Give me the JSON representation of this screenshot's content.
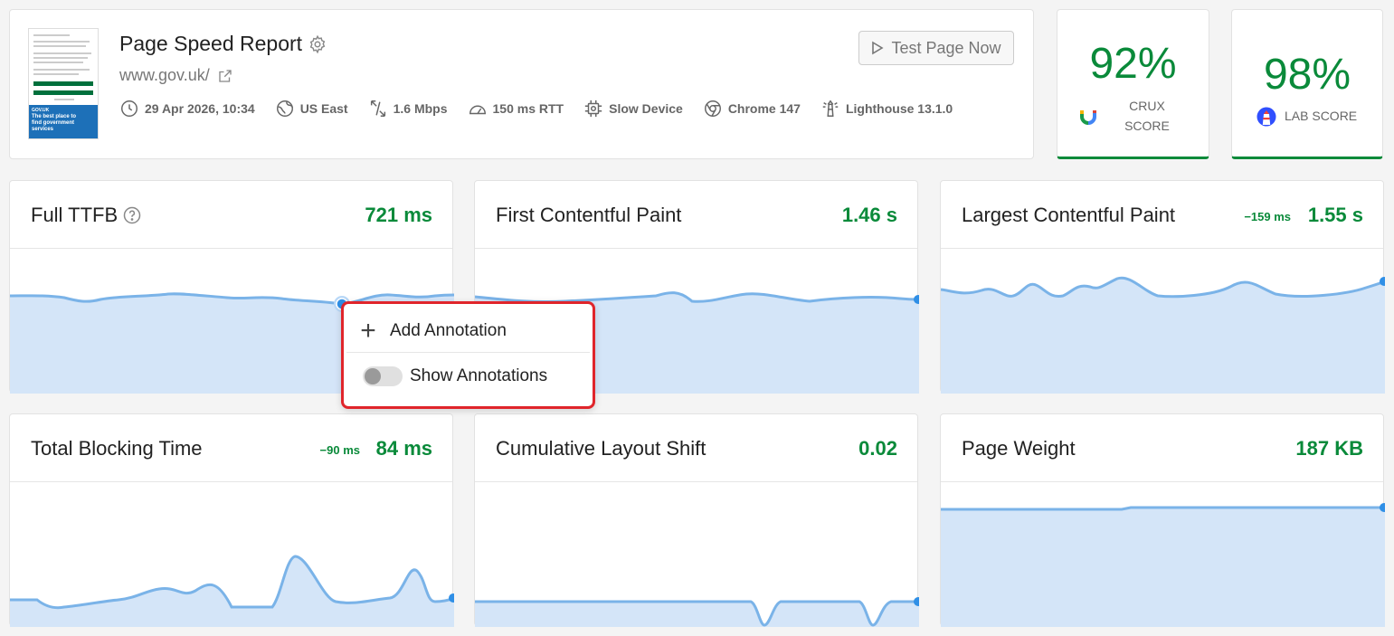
{
  "header": {
    "title": "Page Speed Report",
    "url": "www.gov.uk/",
    "test_button": "Test Page Now",
    "meta": [
      {
        "icon": "clock-icon",
        "label": "29 Apr 2026, 10:34"
      },
      {
        "icon": "globe-icon",
        "label": "US East"
      },
      {
        "icon": "bandwidth-icon",
        "label": "1.6 Mbps"
      },
      {
        "icon": "gauge-icon",
        "label": "150 ms RTT"
      },
      {
        "icon": "cpu-icon",
        "label": "Slow Device"
      },
      {
        "icon": "chrome-icon",
        "label": "Chrome 147"
      },
      {
        "icon": "lighthouse-icon",
        "label": "Lighthouse 13.1.0"
      }
    ],
    "thumbnail": {
      "logo": "GOV.UK",
      "headline": "The best place to find government services"
    }
  },
  "scores": {
    "crux": {
      "value": "92%",
      "label_line1": "CRUX",
      "label_line2": "SCORE"
    },
    "lab": {
      "value": "98%",
      "label": "LAB SCORE"
    }
  },
  "metrics": {
    "ttfb": {
      "title": "Full TTFB",
      "value": "721 ms"
    },
    "fcp": {
      "title": "First Contentful Paint",
      "value": "1.46 s"
    },
    "lcp": {
      "title": "Largest Contentful Paint",
      "value": "1.55 s",
      "delta": "−159 ms"
    },
    "tbt": {
      "title": "Total Blocking Time",
      "value": "84 ms",
      "delta": "−90 ms"
    },
    "cls": {
      "title": "Cumulative Layout Shift",
      "value": "0.02"
    },
    "weight": {
      "title": "Page Weight",
      "value": "187 KB"
    }
  },
  "context_menu": {
    "add_annotation": "Add Annotation",
    "show_annotations": "Show Annotations",
    "show_annotations_enabled": false
  },
  "colors": {
    "good": "#0a8a3a",
    "chart_line": "#7ab3e8",
    "chart_fill": "#d4e5f8",
    "menu_highlight": "#e0252b"
  }
}
